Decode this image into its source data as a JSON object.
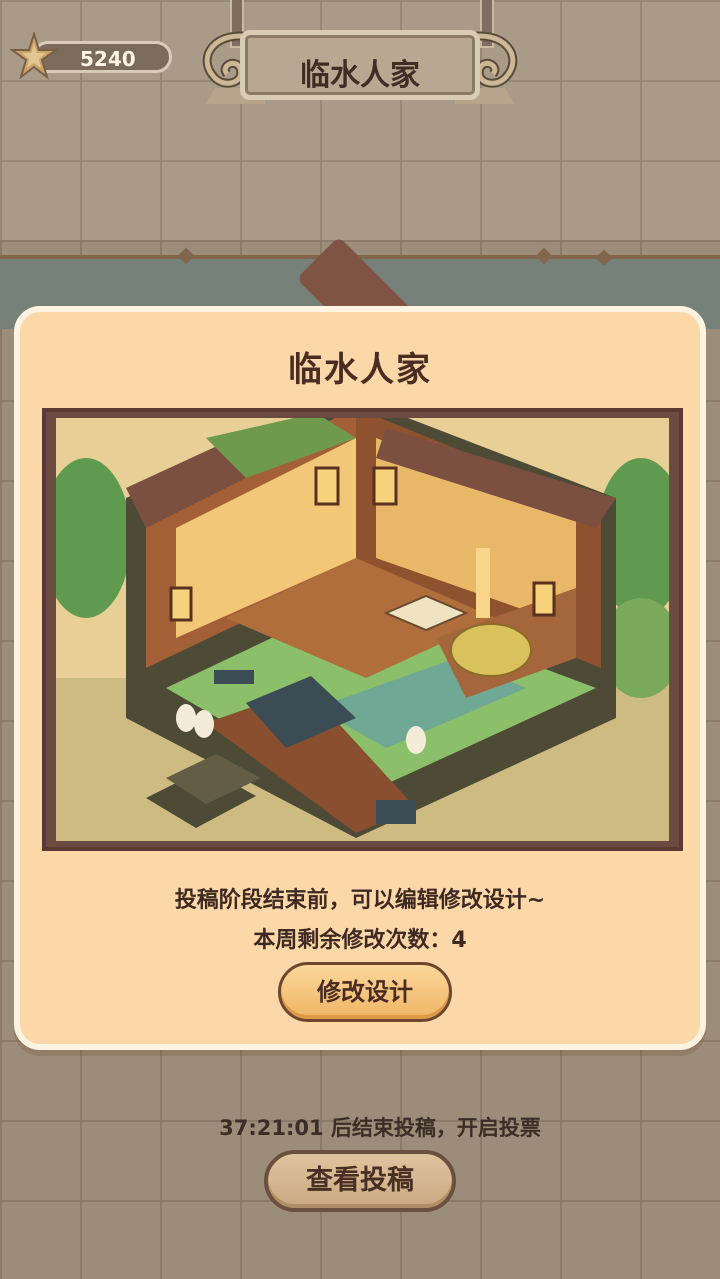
{
  "currency": {
    "icon": "star-icon",
    "value": "5240"
  },
  "top_banner": {
    "title": "临水人家"
  },
  "dialog": {
    "title": "临水人家",
    "preview_image": "isometric-room-preview",
    "description_line1": "投稿阶段结束前，可以编辑修改设计~",
    "description_line2": "本周剩余修改次数：4",
    "edit_button_label": "修改设计"
  },
  "footer": {
    "countdown_text": "37:21:01 后结束投稿，开启投票",
    "view_button_label": "查看投稿"
  },
  "colors": {
    "dialog_bg": "#fcd8a8",
    "dialog_border": "#fff4e2",
    "title_text": "#4a2c22",
    "button_gold": "#f0b565",
    "preview_frame": "#6c4c42"
  }
}
